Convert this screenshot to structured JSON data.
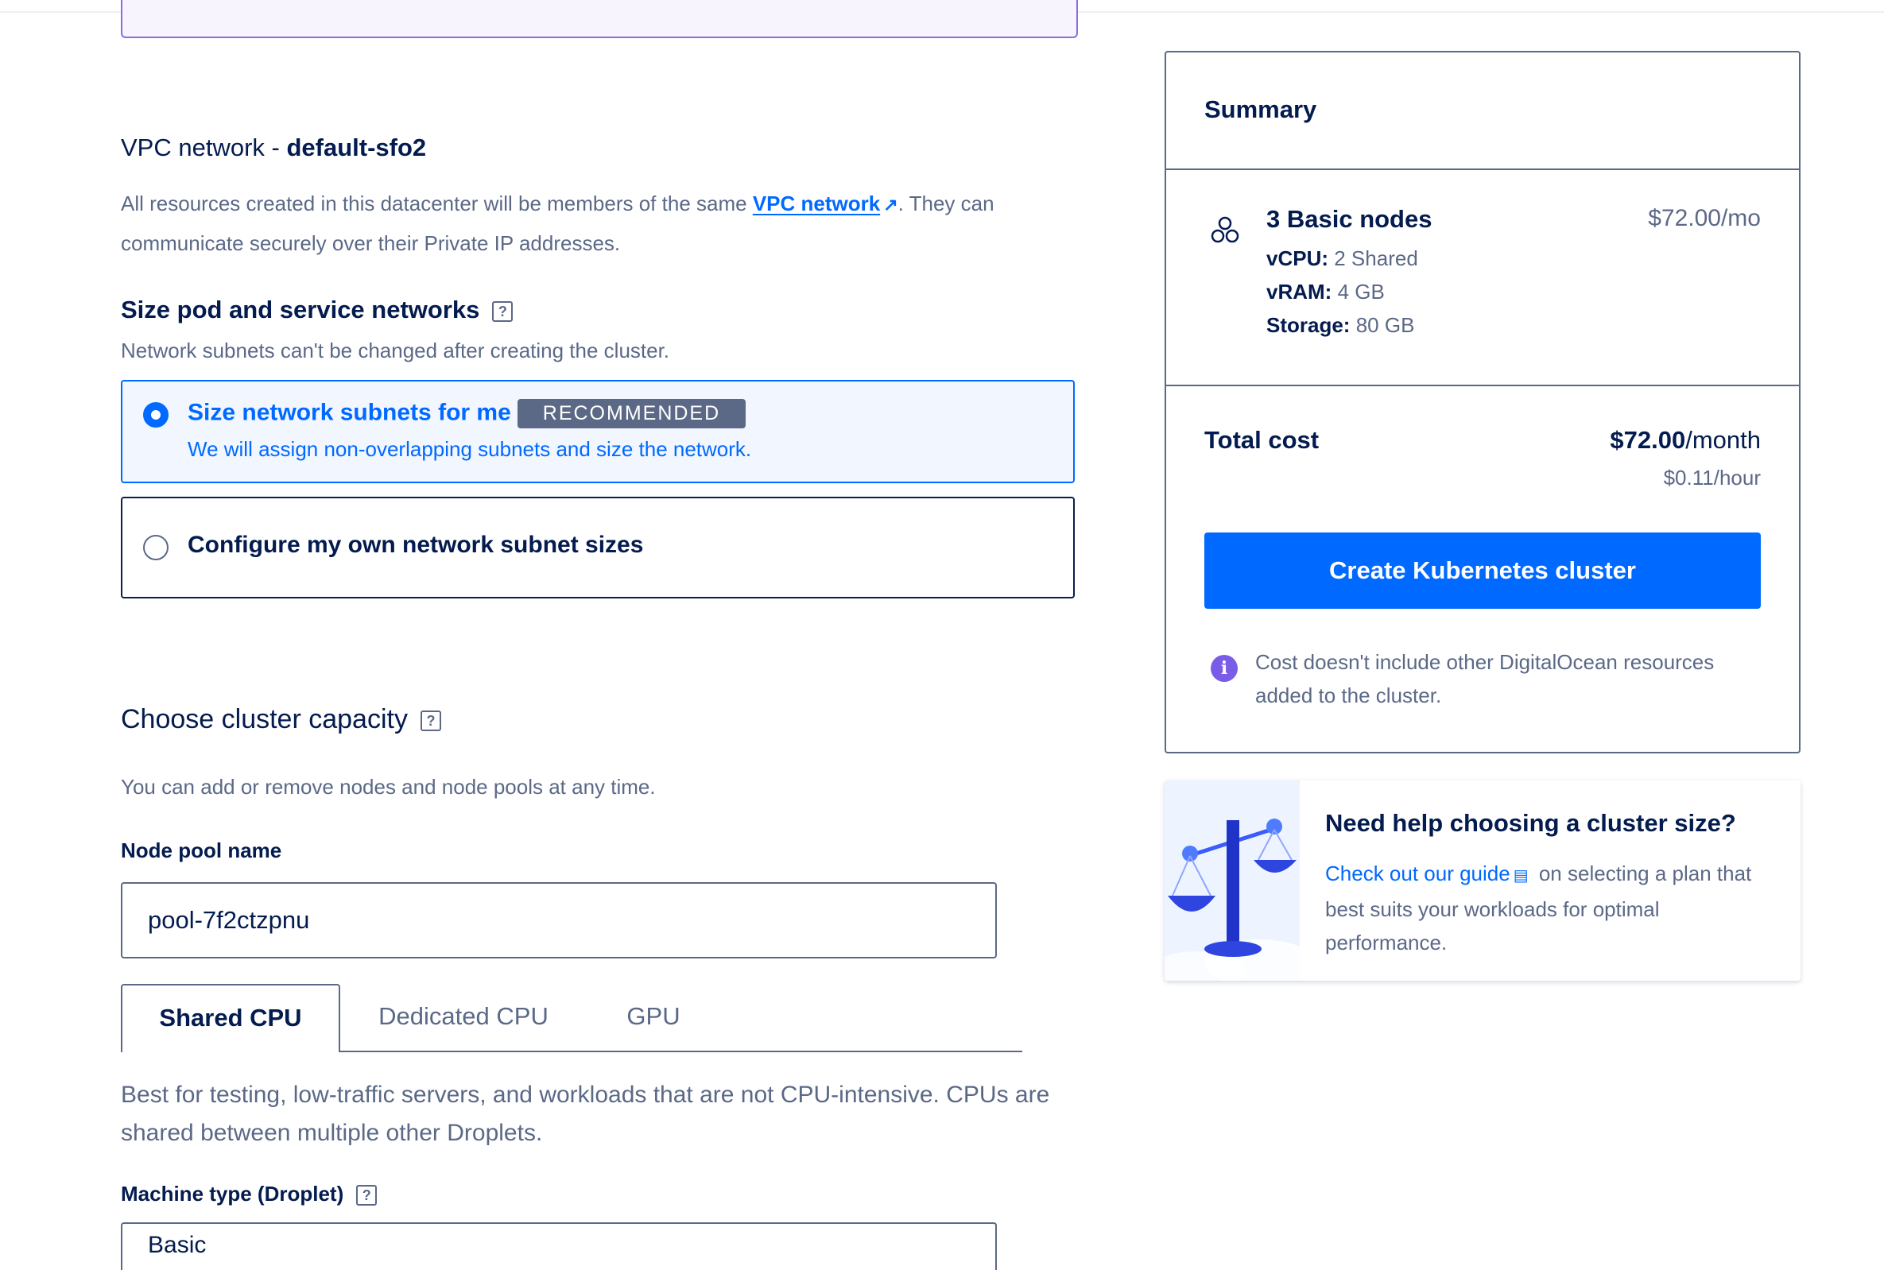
{
  "vpc": {
    "title_prefix": "VPC network - ",
    "title_name": "default-sfo2",
    "desc_before": "All resources created in this datacenter will be members of the same ",
    "desc_link": "VPC network",
    "desc_after": ". They can communicate securely over their Private IP addresses."
  },
  "pod_networks": {
    "title": "Size pod and service networks",
    "help": "?",
    "subtitle": "Network subnets can't be changed after creating the cluster.",
    "options": [
      {
        "label": "Size network subnets for me",
        "badge": "RECOMMENDED",
        "desc": "We will assign non-overlapping subnets and size the network.",
        "selected": true
      },
      {
        "label": "Configure my own network subnet sizes",
        "selected": false
      }
    ]
  },
  "capacity": {
    "title": "Choose cluster capacity",
    "help": "?",
    "subtitle": "You can add or remove nodes and node pools at any time.",
    "pool_label": "Node pool name",
    "pool_value": "pool-7f2ctzpnu",
    "tabs": [
      "Shared CPU",
      "Dedicated CPU",
      "GPU"
    ],
    "active_tab": "Shared CPU",
    "tab_desc": "Best for testing, low-traffic servers, and workloads that are not CPU-intensive. CPUs are shared between multiple other Droplets.",
    "machine_label": "Machine type (Droplet)",
    "machine_value": "Basic"
  },
  "summary": {
    "title": "Summary",
    "node_name": "3 Basic nodes",
    "node_price": "$72.00/mo",
    "vcpu_label": "vCPU:",
    "vcpu_value": "2 Shared",
    "vram_label": "vRAM:",
    "vram_value": "4 GB",
    "storage_label": "Storage:",
    "storage_value": "80 GB",
    "total_label": "Total cost",
    "total_amount": "$72.00",
    "total_unit": "/month",
    "hourly": "$0.11/hour",
    "create_button": "Create Kubernetes cluster",
    "info": "Cost doesn't include other DigitalOcean resources added to the cluster."
  },
  "help_card": {
    "title": "Need help choosing a cluster size?",
    "link": "Check out our guide",
    "text": " on selecting a plan that best suits your workloads for optimal performance."
  },
  "colors": {
    "accent": "#0069ff",
    "text": "#031b4e",
    "muted": "#5b6987",
    "info": "#7a5ce8"
  }
}
